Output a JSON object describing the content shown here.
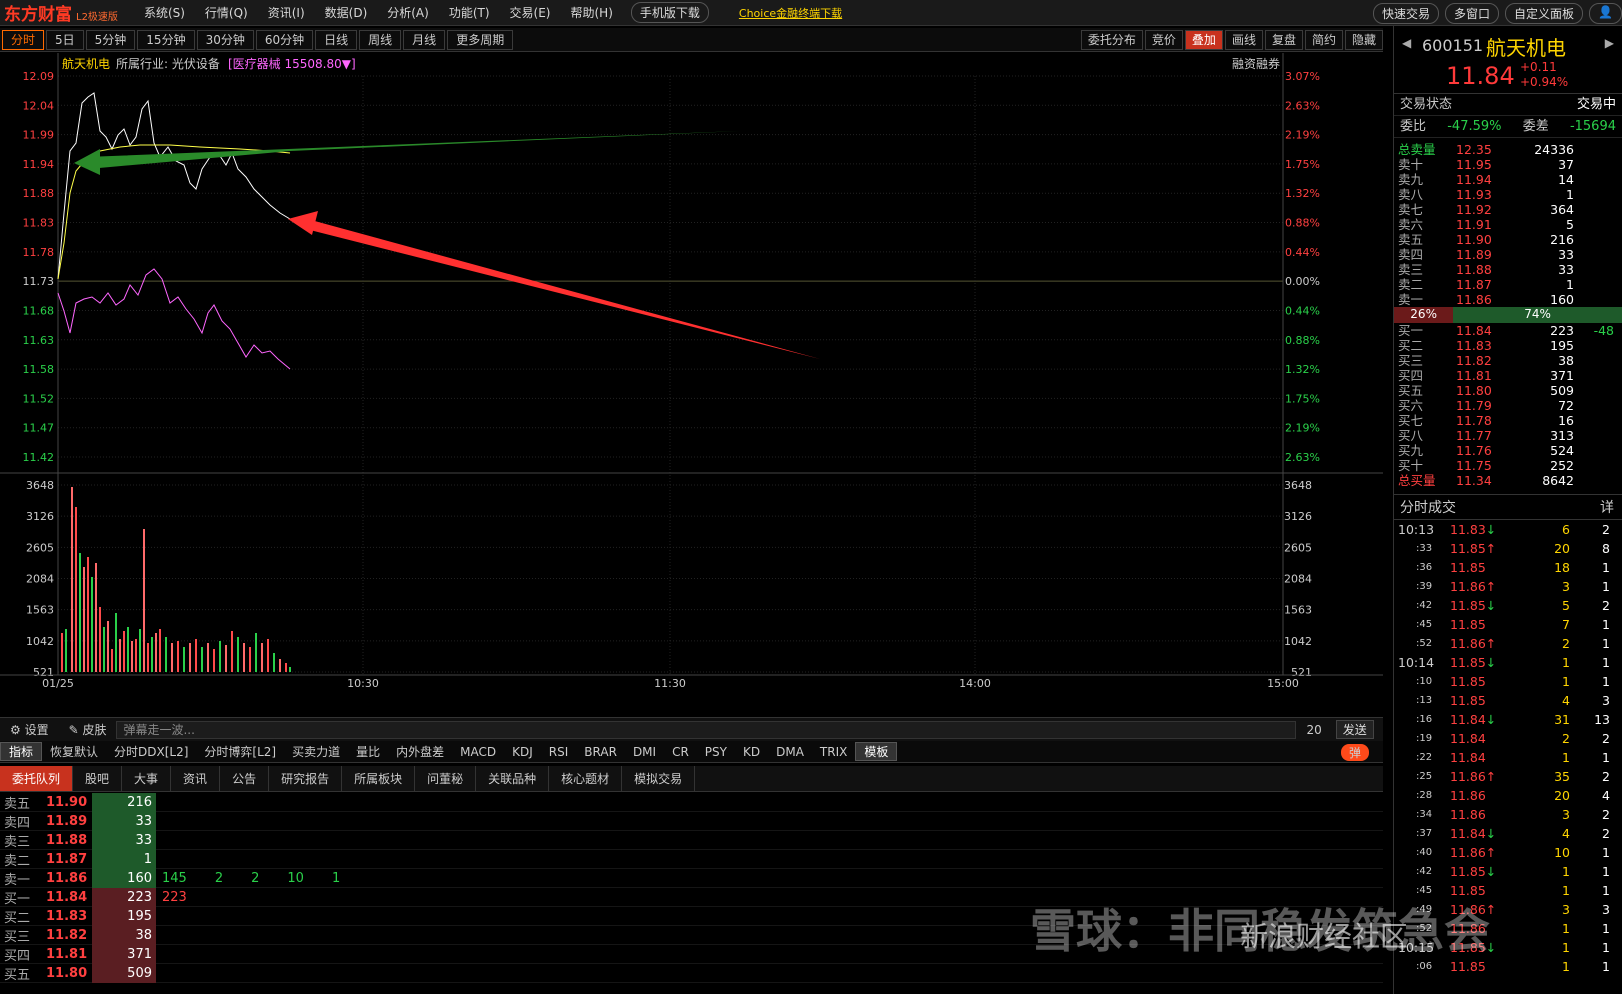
{
  "app": {
    "logo": "东方财富",
    "edition": "L2极速版"
  },
  "menu": [
    "系统(S)",
    "行情(Q)",
    "资讯(I)",
    "数据(D)",
    "分析(A)",
    "功能(T)",
    "交易(E)",
    "帮助(H)"
  ],
  "top": {
    "mobile": "手机版下载",
    "choice": "Choice金融终端下载",
    "fast_trade": "快速交易",
    "multi": "多窗口",
    "custom": "自定义面板"
  },
  "periods": [
    "分时",
    "5日",
    "5分钟",
    "15分钟",
    "30分钟",
    "60分钟",
    "日线",
    "周线",
    "月线",
    "更多周期"
  ],
  "period_right": [
    "委托分布",
    "竞价",
    "叠加",
    "画线",
    "复盘",
    "简约",
    "隐藏"
  ],
  "chart_header": {
    "name": "航天机电",
    "industry": "所属行业: 光伏设备",
    "index": "[医疗器械 15508.80▼]",
    "margin": "融资融券"
  },
  "chart_data": {
    "type": "line",
    "price_ticks": [
      "12.09",
      "12.04",
      "11.99",
      "11.94",
      "11.88",
      "11.83",
      "11.78",
      "11.73",
      "11.68",
      "11.63",
      "11.58",
      "11.52",
      "11.47",
      "11.42"
    ],
    "pct_ticks": [
      "3.07%",
      "2.63%",
      "2.19%",
      "1.75%",
      "1.32%",
      "0.88%",
      "0.44%",
      "0.00%",
      "0.44%",
      "0.88%",
      "1.32%",
      "1.75%",
      "2.19%",
      "2.63%"
    ],
    "vol_ticks": [
      "3648",
      "3126",
      "2605",
      "2084",
      "1563",
      "1042",
      "521"
    ],
    "time_ticks": [
      "01/25",
      "10:30",
      "11:30",
      "14:00",
      "15:00"
    ],
    "ylim": [
      11.42,
      12.09
    ]
  },
  "controls": {
    "settings": "设置",
    "skin": "皮肤",
    "danmu": "弹幕走一波...",
    "count": "20",
    "send": "发送"
  },
  "indicators": [
    "指标",
    "恢复默认",
    "分时DDX[L2]",
    "分时博弈[L2]",
    "买卖力道",
    "量比",
    "内外盘差",
    "MACD",
    "KDJ",
    "RSI",
    "BRAR",
    "DMI",
    "CR",
    "PSY",
    "KD",
    "DMA",
    "TRIX",
    "模板"
  ],
  "toggle": "弹",
  "bottom_tabs": [
    "委托队列",
    "股吧",
    "大事",
    "资讯",
    "公告",
    "研究报告",
    "所属板块",
    "问董秘",
    "关联品种",
    "核心题材",
    "模拟交易"
  ],
  "queue": [
    {
      "label": "卖五",
      "price": "11.90",
      "vol": "216",
      "side": "sell",
      "extra": []
    },
    {
      "label": "卖四",
      "price": "11.89",
      "vol": "33",
      "side": "sell",
      "extra": []
    },
    {
      "label": "卖三",
      "price": "11.88",
      "vol": "33",
      "side": "sell",
      "extra": []
    },
    {
      "label": "卖二",
      "price": "11.87",
      "vol": "1",
      "side": "sell",
      "extra": []
    },
    {
      "label": "卖一",
      "price": "11.86",
      "vol": "160",
      "side": "sell",
      "extra": [
        "145",
        "2",
        "2",
        "10",
        "1"
      ]
    },
    {
      "label": "买一",
      "price": "11.84",
      "vol": "223",
      "side": "buy",
      "extra": [
        "223"
      ]
    },
    {
      "label": "买二",
      "price": "11.83",
      "vol": "195",
      "side": "buy",
      "extra": []
    },
    {
      "label": "买三",
      "price": "11.82",
      "vol": "38",
      "side": "buy",
      "extra": []
    },
    {
      "label": "买四",
      "price": "11.81",
      "vol": "371",
      "side": "buy",
      "extra": []
    },
    {
      "label": "买五",
      "price": "11.80",
      "vol": "509",
      "side": "buy",
      "extra": []
    }
  ],
  "stock": {
    "code": "600151",
    "name": "航天机电",
    "price": "11.84",
    "chg": "+0.11",
    "pct": "+0.94%",
    "status_label": "交易状态",
    "status": "交易中",
    "wb_label": "委比",
    "wb": "-47.59%",
    "wc_label": "委差",
    "wc": "-15694"
  },
  "book": [
    {
      "a": "总卖量",
      "b": "12.35",
      "c": "24336",
      "d": ""
    },
    {
      "a": "卖十",
      "b": "11.95",
      "c": "37",
      "d": ""
    },
    {
      "a": "卖九",
      "b": "11.94",
      "c": "14",
      "d": ""
    },
    {
      "a": "卖八",
      "b": "11.93",
      "c": "1",
      "d": ""
    },
    {
      "a": "卖七",
      "b": "11.92",
      "c": "364",
      "d": ""
    },
    {
      "a": "卖六",
      "b": "11.91",
      "c": "5",
      "d": ""
    },
    {
      "a": "卖五",
      "b": "11.90",
      "c": "216",
      "d": ""
    },
    {
      "a": "卖四",
      "b": "11.89",
      "c": "33",
      "d": ""
    },
    {
      "a": "卖三",
      "b": "11.88",
      "c": "33",
      "d": ""
    },
    {
      "a": "卖二",
      "b": "11.87",
      "c": "1",
      "d": ""
    },
    {
      "a": "卖一",
      "b": "11.86",
      "c": "160",
      "d": ""
    }
  ],
  "ratio": {
    "buy": "26%",
    "sell": "74%"
  },
  "book_buy": [
    {
      "a": "买一",
      "b": "11.84",
      "c": "223",
      "d": "-48"
    },
    {
      "a": "买二",
      "b": "11.83",
      "c": "195",
      "d": ""
    },
    {
      "a": "买三",
      "b": "11.82",
      "c": "38",
      "d": ""
    },
    {
      "a": "买四",
      "b": "11.81",
      "c": "371",
      "d": ""
    },
    {
      "a": "买五",
      "b": "11.80",
      "c": "509",
      "d": ""
    },
    {
      "a": "买六",
      "b": "11.79",
      "c": "72",
      "d": ""
    },
    {
      "a": "买七",
      "b": "11.78",
      "c": "16",
      "d": ""
    },
    {
      "a": "买八",
      "b": "11.77",
      "c": "313",
      "d": ""
    },
    {
      "a": "买九",
      "b": "11.76",
      "c": "524",
      "d": ""
    },
    {
      "a": "买十",
      "b": "11.75",
      "c": "252",
      "d": ""
    },
    {
      "a": "总买量",
      "b": "11.34",
      "c": "8642",
      "d": ""
    }
  ],
  "ticks_title": "分时成交",
  "ticks_detail": "详",
  "ticks": [
    {
      "t": "10:13",
      "p": "11.83",
      "ar": "↓",
      "v": "6",
      "n": "2"
    },
    {
      "t": ":33",
      "p": "11.85",
      "ar": "↑",
      "v": "20",
      "n": "8"
    },
    {
      "t": ":36",
      "p": "11.85",
      "ar": "",
      "v": "18",
      "n": "1"
    },
    {
      "t": ":39",
      "p": "11.86",
      "ar": "↑",
      "v": "3",
      "n": "1"
    },
    {
      "t": ":42",
      "p": "11.85",
      "ar": "↓",
      "v": "5",
      "n": "2"
    },
    {
      "t": ":45",
      "p": "11.85",
      "ar": "",
      "v": "7",
      "n": "1"
    },
    {
      "t": ":52",
      "p": "11.86",
      "ar": "↑",
      "v": "2",
      "n": "1"
    },
    {
      "t": "10:14",
      "p": "11.85",
      "ar": "↓",
      "v": "1",
      "n": "1"
    },
    {
      "t": ":10",
      "p": "11.85",
      "ar": "",
      "v": "1",
      "n": "1"
    },
    {
      "t": ":13",
      "p": "11.85",
      "ar": "",
      "v": "4",
      "n": "3"
    },
    {
      "t": ":16",
      "p": "11.84",
      "ar": "↓",
      "v": "31",
      "n": "13"
    },
    {
      "t": ":19",
      "p": "11.84",
      "ar": "",
      "v": "2",
      "n": "2"
    },
    {
      "t": ":22",
      "p": "11.84",
      "ar": "",
      "v": "1",
      "n": "1"
    },
    {
      "t": ":25",
      "p": "11.86",
      "ar": "↑",
      "v": "35",
      "n": "2"
    },
    {
      "t": ":28",
      "p": "11.86",
      "ar": "",
      "v": "20",
      "n": "4"
    },
    {
      "t": ":34",
      "p": "11.86",
      "ar": "",
      "v": "3",
      "n": "2"
    },
    {
      "t": ":37",
      "p": "11.84",
      "ar": "↓",
      "v": "4",
      "n": "2"
    },
    {
      "t": ":40",
      "p": "11.86",
      "ar": "↑",
      "v": "10",
      "n": "1"
    },
    {
      "t": ":42",
      "p": "11.85",
      "ar": "↓",
      "v": "1",
      "n": "1"
    },
    {
      "t": ":45",
      "p": "11.85",
      "ar": "",
      "v": "1",
      "n": "1"
    },
    {
      "t": ":49",
      "p": "11.86",
      "ar": "↑",
      "v": "3",
      "n": "3"
    },
    {
      "t": ":52",
      "p": "11.86",
      "ar": "",
      "v": "1",
      "n": "1"
    },
    {
      "t": "10:15",
      "p": "11.85",
      "ar": "↓",
      "v": "1",
      "n": "1"
    },
    {
      "t": ":06",
      "p": "11.85",
      "ar": "",
      "v": "1",
      "n": "1"
    }
  ],
  "watermark": "雪球：非同稳发筑急会",
  "sina": "新浪财经社区"
}
